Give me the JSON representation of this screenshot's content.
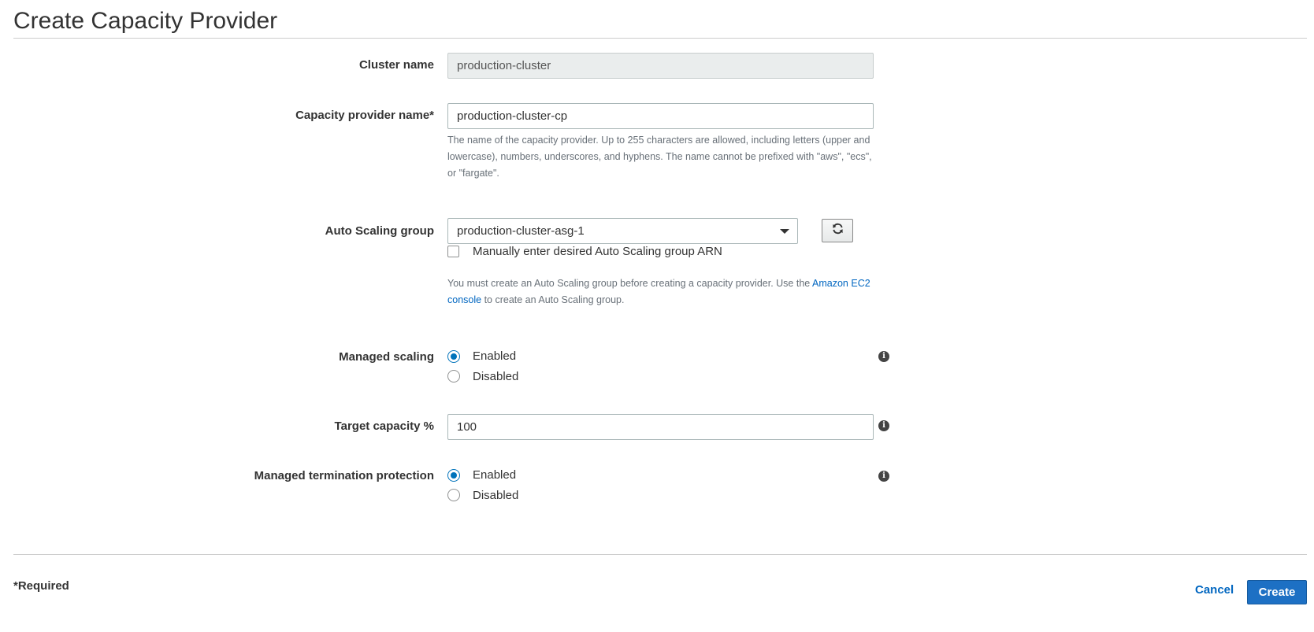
{
  "page": {
    "title": "Create Capacity Provider"
  },
  "cluster_name": {
    "label": "Cluster name",
    "value": "production-cluster"
  },
  "capacity_provider_name": {
    "label": "Capacity provider name*",
    "value": "production-cluster-cp",
    "help": "The name of the capacity provider. Up to 255 characters are allowed, including letters (upper and lowercase), numbers, underscores, and hyphens. The name cannot be prefixed with \"aws\", \"ecs\", or \"fargate\"."
  },
  "auto_scaling_group": {
    "label": "Auto Scaling group",
    "selected": "production-cluster-asg-1",
    "refresh_icon": "refresh-icon",
    "manual_checkbox_label": "Manually enter desired Auto Scaling group ARN",
    "manual_checkbox_checked": false,
    "help_before_link": "You must create an Auto Scaling group before creating a capacity provider. Use the ",
    "help_link": "Amazon EC2 console",
    "help_after_link": " to create an Auto Scaling group."
  },
  "managed_scaling": {
    "label": "Managed scaling",
    "options": [
      "Enabled",
      "Disabled"
    ],
    "selected": "Enabled",
    "info_icon": "info-icon"
  },
  "target_capacity": {
    "label": "Target capacity %",
    "value": "100",
    "info_icon": "info-icon"
  },
  "managed_termination_protection": {
    "label": "Managed termination protection",
    "options": [
      "Enabled",
      "Disabled"
    ],
    "selected": "Enabled",
    "info_icon": "info-icon"
  },
  "footer": {
    "required_note": "*Required",
    "cancel_label": "Cancel",
    "create_label": "Create"
  },
  "colors": {
    "primary_button": "#1d70c4",
    "link": "#0066c0",
    "radio_selected": "#0073bb"
  }
}
